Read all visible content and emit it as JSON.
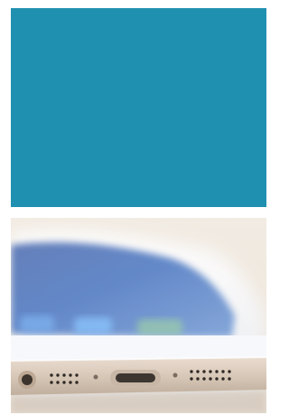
{
  "colors": {
    "tile": "#2090b0",
    "background": "#ffffff"
  },
  "photo": {
    "subject": "smartphone-bottom-edge"
  }
}
